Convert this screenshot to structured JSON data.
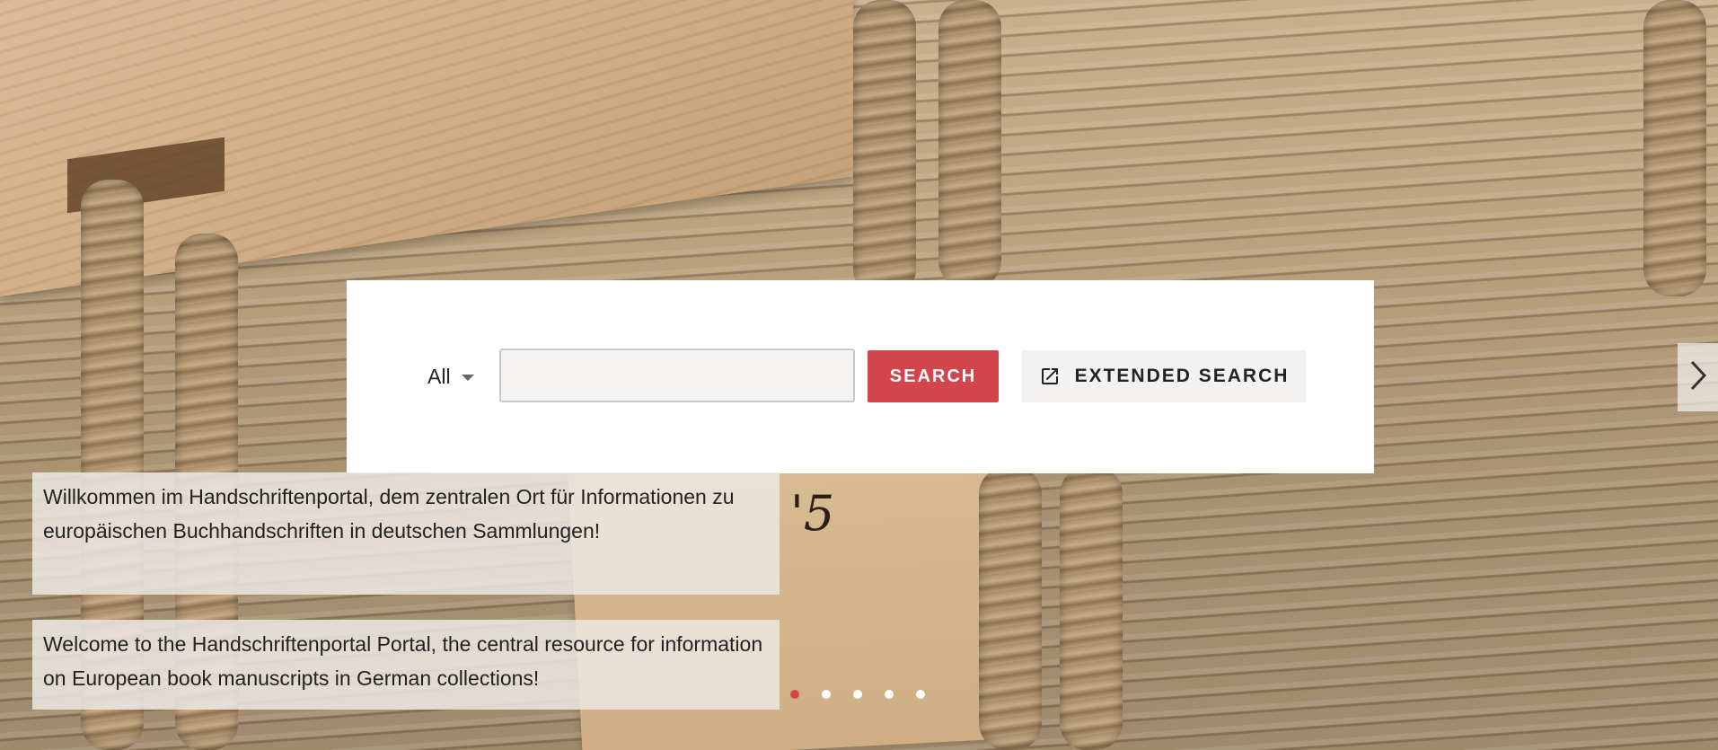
{
  "search": {
    "scope_label": "All",
    "query_value": "",
    "search_label": "SEARCH",
    "extended_label": "EXTENDED SEARCH"
  },
  "hero": {
    "welcome_de": "Willkommen im Handschriftenportal, dem zentralen Ort für Informationen zu europäischen Buchhandschriften in deutschen Sammlungen!",
    "welcome_en": "Welcome to the Handschriftenportal Portal, the central resource for information on European book manuscripts in German collections!"
  },
  "carousel": {
    "slide_count": 5,
    "active_index": 0
  },
  "colors": {
    "accent": "#d3454c",
    "panel": "#ffffff",
    "button_secondary": "#f3f2f0"
  }
}
